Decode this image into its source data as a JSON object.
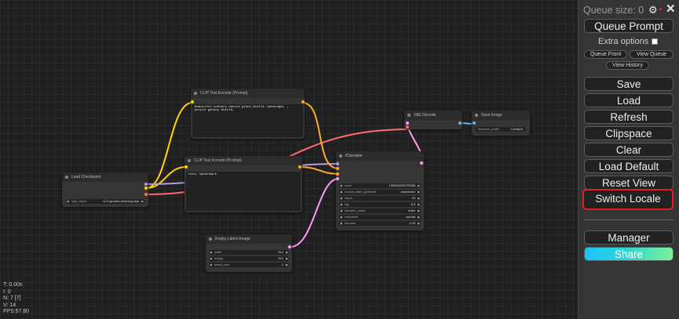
{
  "panel": {
    "queue_size": "Queue size: 0",
    "queue_prompt": "Queue Prompt",
    "extra_options": "Extra options",
    "queue_front": "Queue Front",
    "view_queue": "View Queue",
    "view_history": "View History",
    "save": "Save",
    "load": "Load",
    "refresh": "Refresh",
    "clipspace": "Clipspace",
    "clear": "Clear",
    "load_default": "Load Default",
    "reset_view": "Reset View",
    "switch_locale": "Switch Locale",
    "manager": "Manager",
    "share": "Share",
    "gear_icon": "gear-icon",
    "close_icon": "close-icon"
  },
  "stats": {
    "t": "T: 0.00s",
    "i": "I: 0",
    "n": "N: 7 [7]",
    "v": "V: 14",
    "fps": "FPS:57.80"
  },
  "nodes": {
    "load_checkpoint": {
      "title": "Load Checkpoint",
      "ckpt_label": "ckpt_name",
      "ckpt_value": "v1-5-pruned-emaonly.ckpt"
    },
    "clip_pos": {
      "title": "CLIP Text Encode (Prompt)",
      "text": "beautiful scenery nature glass bottle landscape, , purple galaxy bottle,"
    },
    "clip_neg": {
      "title": "CLIP Text Encode (Prompt)",
      "text": "text, watermark"
    },
    "empty_latent": {
      "title": "Empty Latent Image",
      "widgets": [
        {
          "label": "width",
          "value": "512"
        },
        {
          "label": "height",
          "value": "512"
        },
        {
          "label": "batch_size",
          "value": "1"
        }
      ]
    },
    "ksampler": {
      "title": "KSampler",
      "widgets": [
        {
          "label": "seed",
          "value": "156680208700286"
        },
        {
          "label": "control_after_generate",
          "value": "randomize"
        },
        {
          "label": "steps",
          "value": "20"
        },
        {
          "label": "cfg",
          "value": "8.0"
        },
        {
          "label": "sampler_name",
          "value": "euler"
        },
        {
          "label": "scheduler",
          "value": "normal"
        },
        {
          "label": "denoise",
          "value": "1.00"
        }
      ]
    },
    "vae_decode": {
      "title": "VAE Decode"
    },
    "save_image": {
      "title": "Save Image",
      "prefix_label": "filename_prefix",
      "prefix_value": "ComfyUI"
    }
  },
  "colors": {
    "model": "#b39ddb",
    "clip": "#ffd500",
    "vae": "#ff6e6e",
    "conditioning": "#ffa931",
    "latent": "#ff9cf9",
    "image": "#64b5f6",
    "highlight": "#e02020"
  }
}
